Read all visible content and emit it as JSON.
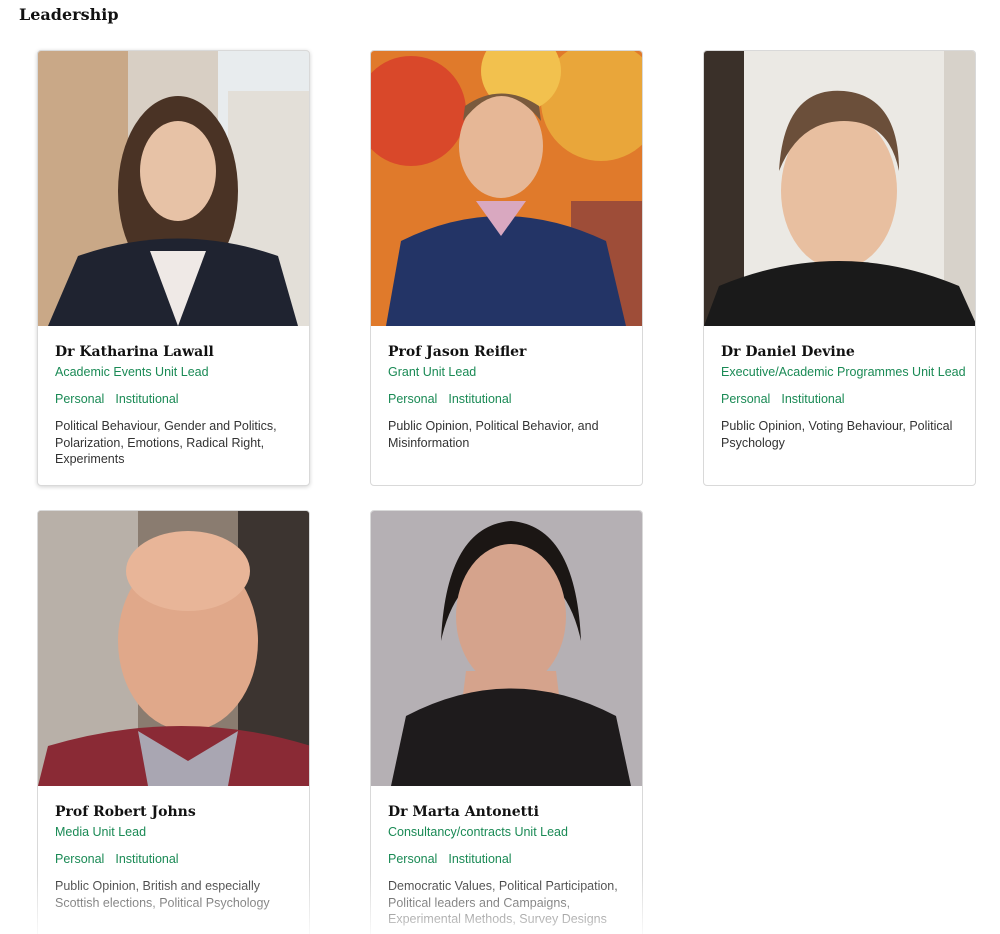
{
  "section": {
    "title": "Leadership"
  },
  "people": [
    {
      "name": "Dr Katharina Lawall",
      "role": "Academic Events Unit Lead",
      "links": [
        "Personal",
        "Institutional"
      ],
      "interests": "Political Behaviour, Gender and Politics, Polarization, Emotions, Radical Right, Experiments"
    },
    {
      "name": "Prof Jason Reifler",
      "role": "Grant Unit Lead",
      "links": [
        "Personal",
        "Institutional"
      ],
      "interests": "Public Opinion, Political Behavior, and Misinformation"
    },
    {
      "name": "Dr Daniel Devine",
      "role": "Executive/Academic Programmes Unit Lead",
      "links": [
        "Personal",
        "Institutional"
      ],
      "interests": "Public Opinion, Voting Behaviour, Political Psychology"
    },
    {
      "name": "Prof Robert Johns",
      "role": "Media Unit Lead",
      "links": [
        "Personal",
        "Institutional"
      ],
      "interests": "Public Opinion, British and especially Scottish elections, Political Psychology"
    },
    {
      "name": "Dr Marta Antonetti",
      "role": "Consultancy/contracts Unit Lead",
      "links": [
        "Personal",
        "Institutional"
      ],
      "interests": "Democratic Values, Political Participation, Political leaders and Campaigns, Experimental Methods, Survey Designs"
    }
  ],
  "colors": {
    "accent": "#1a8a55"
  }
}
